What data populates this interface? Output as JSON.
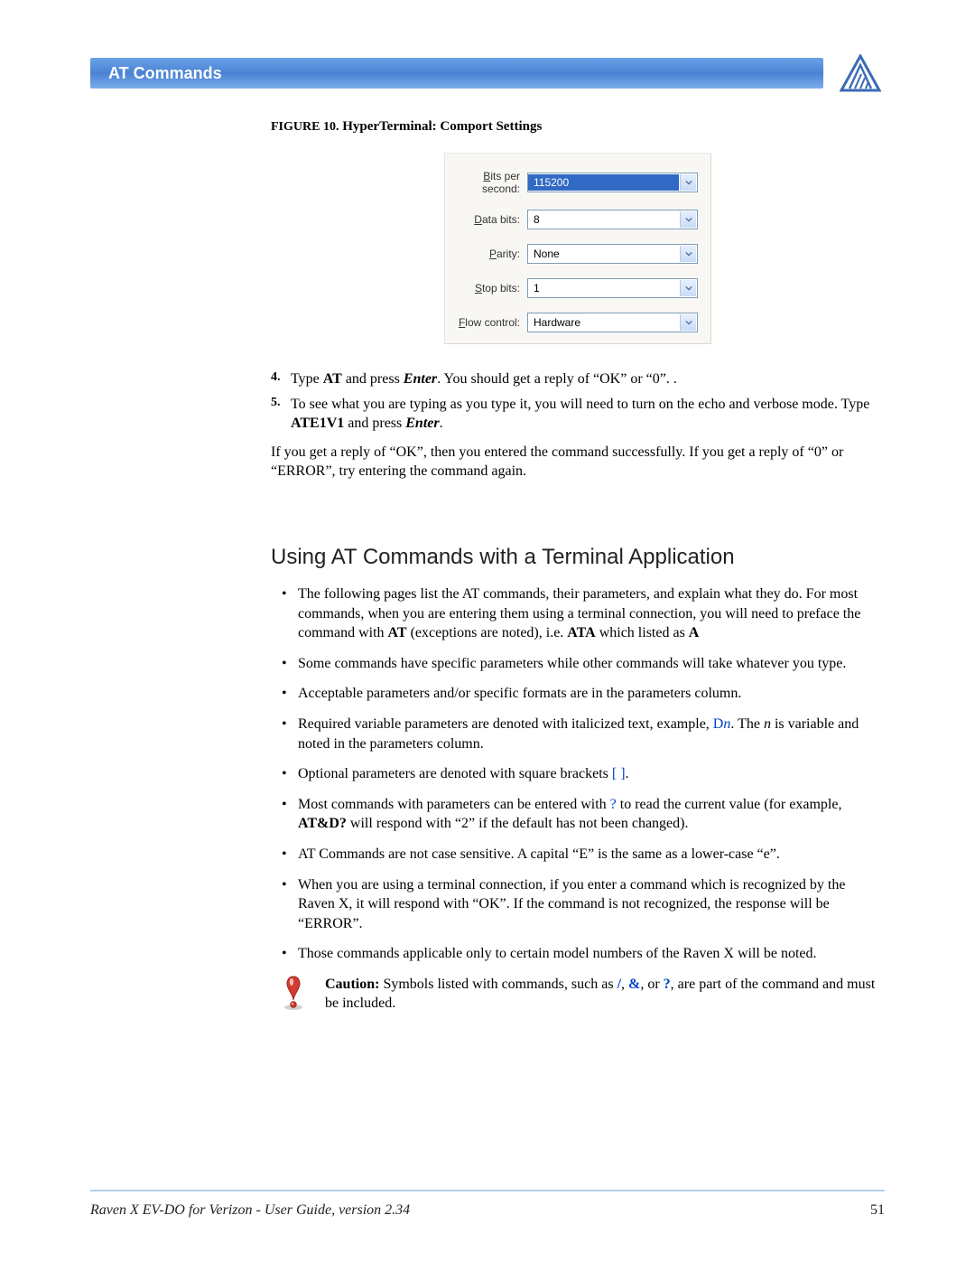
{
  "header": {
    "title": "AT Commands"
  },
  "figure": {
    "prefix": "FIGURE 10.",
    "title": "HyperTerminal: Comport Settings",
    "rows": {
      "bits_per_second_label_pre": "B",
      "bits_per_second_label": "its per second:",
      "bits_per_second_value": "115200",
      "data_bits_label_pre": "D",
      "data_bits_label": "ata bits:",
      "data_bits_value": "8",
      "parity_label_pre": "P",
      "parity_label": "arity:",
      "parity_value": "None",
      "stop_bits_label_pre": "S",
      "stop_bits_label": "top bits:",
      "stop_bits_value": "1",
      "flow_control_label_pre": "F",
      "flow_control_label": "low control:",
      "flow_control_value": "Hardware"
    }
  },
  "steps": {
    "s4_a": "Type ",
    "s4_b": "AT",
    "s4_c": " and press ",
    "s4_d": "Enter",
    "s4_e": ".  You should get a reply of “OK” or “0”. .",
    "s5_a": "To see what you are typing as you type it, you will need to turn on the echo and verbose mode. Type ",
    "s5_b": "ATE1V1",
    "s5_c": " and press ",
    "s5_d": "Enter",
    "s5_e": "."
  },
  "after_steps": "If you get a reply of “OK”, then you entered the command successfully.  If you get a reply of “0” or “ERROR”, try entering the command again.",
  "section_heading": "Using AT Commands with a Terminal Application",
  "bullets": {
    "b1_a": "The following pages list the AT commands, their parameters, and explain what they do. For most commands, when you are entering them using a terminal connection, you will need to preface the command with ",
    "b1_b": "AT",
    "b1_c": " (exceptions are noted), i.e. ",
    "b1_d": "ATA",
    "b1_e": " which listed as ",
    "b1_f": "A",
    "b2": "Some commands have specific parameters while other commands will take whatever you type.",
    "b3": " Acceptable parameters and/or specific formats are in the parameters column.",
    "b4_a": " Required variable parameters are denoted with italicized text, example, ",
    "b4_b": "D",
    "b4_c": "n",
    "b4_d": ".  The ",
    "b4_e": "n",
    "b4_f": " is variable and noted in the parameters column.",
    "b5_a": "Optional parameters are denoted with square brackets ",
    "b5_b": "[ ]",
    "b5_c": ".",
    "b6_a": "Most commands with parameters can be entered with ",
    "b6_b": "?",
    "b6_c": " to read the current value (for example, ",
    "b6_d": "AT&D?",
    "b6_e": " will respond with “2” if the default has not been changed).",
    "b7": "AT Commands are not case sensitive.  A capital “E” is the same as a lower-case “e”.",
    "b8": "When you are using a terminal connection, if you enter a command which is recognized by the Raven X, it will respond with “OK”.  If the command is not recognized, the response will be “ERROR”.",
    "b9": "Those commands applicable only to certain model numbers of the Raven X will be noted."
  },
  "caution": {
    "label": "Caution:",
    "a": " Symbols listed with commands, such as ",
    "sym1": "/",
    "sep1": ", ",
    "sym2": "&",
    "sep2": ", or ",
    "sym3": "?",
    "b": ", are part of the com­mand and must be included."
  },
  "footer": {
    "title": "Raven X EV-DO for Verizon - User Guide, version 2.34",
    "page": "51"
  }
}
